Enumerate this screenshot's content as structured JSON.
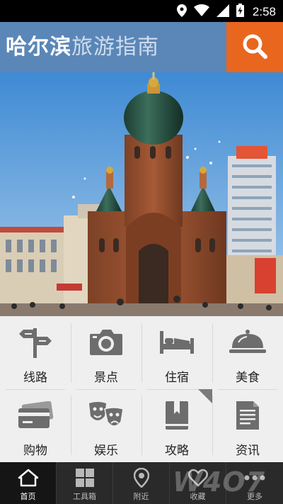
{
  "status_bar": {
    "time": "2:58",
    "icons": [
      "location-icon",
      "wifi-icon",
      "signal-icon",
      "battery-charging-icon"
    ]
  },
  "header": {
    "title_main": "哈尔滨",
    "title_sub": "旅游指南",
    "search_icon": "search-icon",
    "bg_color": "#5a87b7",
    "accent_color": "#e9661f"
  },
  "banner": {
    "image": "saint-sophia-cathedral-photo"
  },
  "grid": {
    "items": [
      {
        "label": "线路",
        "icon": "signpost-icon"
      },
      {
        "label": "景点",
        "icon": "camera-icon"
      },
      {
        "label": "住宿",
        "icon": "bed-icon"
      },
      {
        "label": "美食",
        "icon": "food-cloche-icon"
      },
      {
        "label": "购物",
        "icon": "credit-card-icon"
      },
      {
        "label": "娱乐",
        "icon": "theater-masks-icon"
      },
      {
        "label": "攻略",
        "icon": "guidebook-icon"
      },
      {
        "label": "资讯",
        "icon": "news-document-icon"
      }
    ]
  },
  "bottom_nav": {
    "items": [
      {
        "label": "首页",
        "icon": "home-icon",
        "active": true
      },
      {
        "label": "工具箱",
        "icon": "toolbox-grid-icon",
        "active": false
      },
      {
        "label": "附近",
        "icon": "location-pin-icon",
        "active": false
      },
      {
        "label": "收藏",
        "icon": "heart-icon",
        "active": false
      },
      {
        "label": "更多",
        "icon": "more-dots-icon",
        "active": false
      }
    ]
  },
  "watermark": "W4O7"
}
